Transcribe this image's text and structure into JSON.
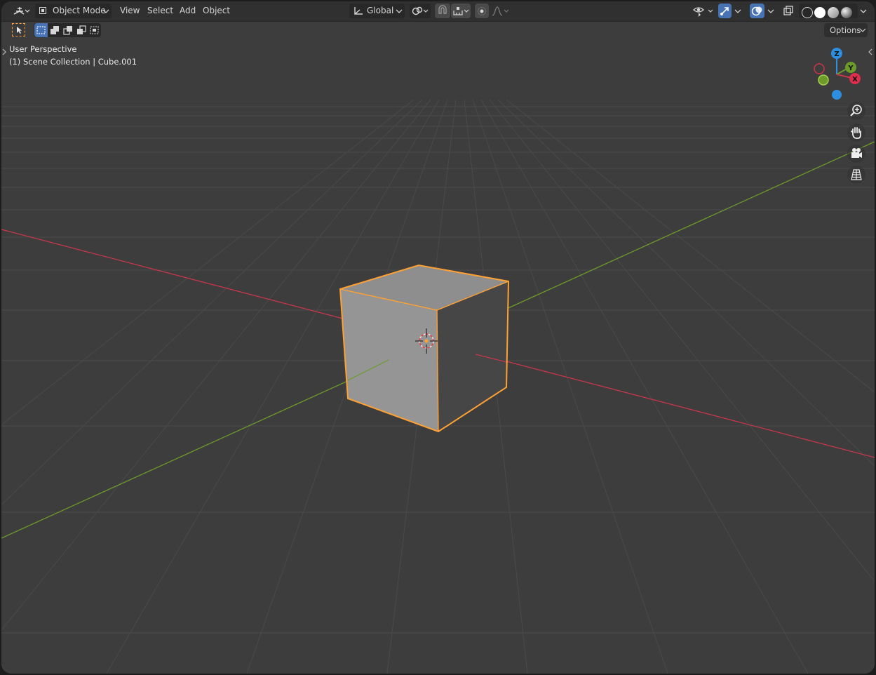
{
  "header": {
    "mode_label": "Object Mode",
    "menus": [
      "View",
      "Select",
      "Add",
      "Object"
    ],
    "transform_orientation": "Global"
  },
  "toolbar": {
    "options_label": "Options"
  },
  "viewport": {
    "view_name": "User Perspective",
    "collection_info": "(1) Scene Collection | Cube.001"
  },
  "gizmo": {
    "axes": [
      "Z",
      "Y",
      "X"
    ]
  },
  "colors": {
    "x_axis": "#c6374b",
    "y_axis": "#6d9b2a",
    "z_axis": "#2e8ee0",
    "selection_outline": "#ffa133",
    "active_button": "#4772b3"
  }
}
